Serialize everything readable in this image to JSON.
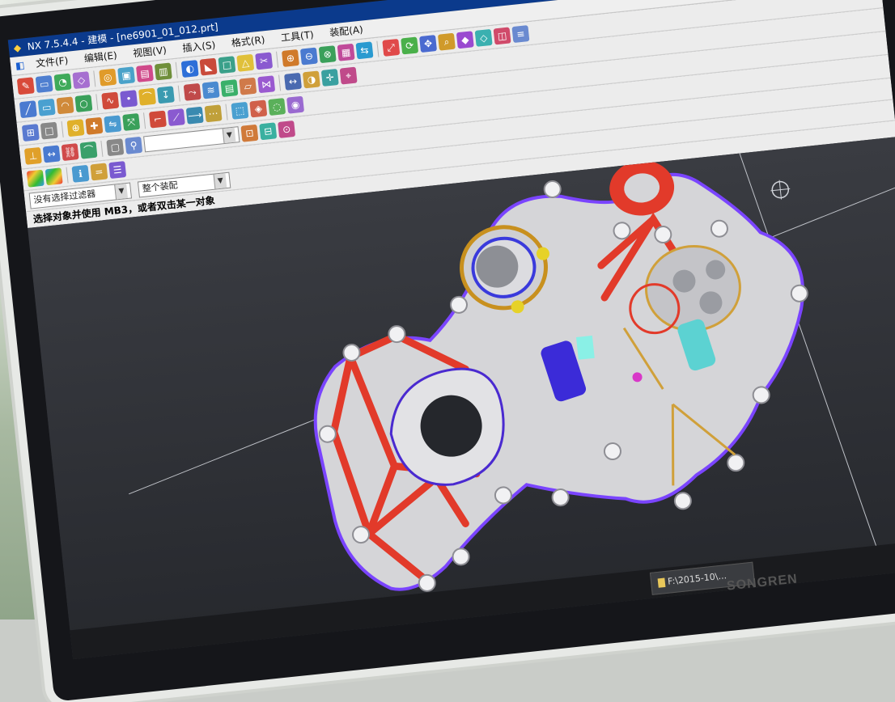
{
  "window": {
    "title": "NX 7.5.4.4 - 建模 - [ne6901_01_012.prt]"
  },
  "menu": [
    {
      "label": "文件(F)"
    },
    {
      "label": "编辑(E)"
    },
    {
      "label": "视图(V)"
    },
    {
      "label": "插入(S)"
    },
    {
      "label": "格式(R)"
    },
    {
      "label": "工具(T)"
    },
    {
      "label": "装配(A)"
    }
  ],
  "selection_bar": {
    "filter_value": "没有选择过滤器",
    "scope_value": "整个装配"
  },
  "prompt": {
    "text": "选择对象并使用 MB3，或者双击某一对象"
  },
  "taskbar": [
    {
      "label": "F:\\2015-10\\..."
    }
  ],
  "monitor_brand": "SONGREN",
  "colors": {
    "titlebar": "#0b3a8c",
    "model_ribs": "#e23a2a",
    "model_body": "#cfcfd2",
    "edge_purple": "#7a44ff",
    "background": "#2e3035"
  }
}
